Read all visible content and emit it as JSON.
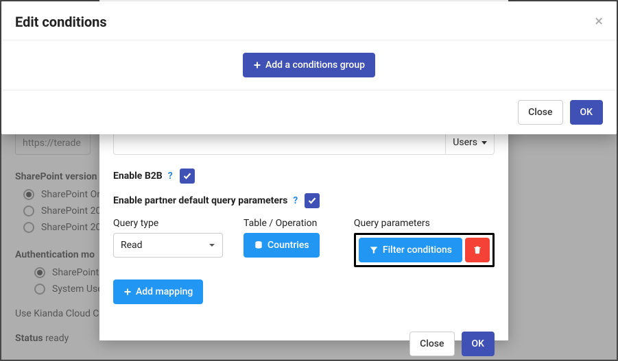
{
  "top_modal": {
    "title": "Edit conditions",
    "add_group_label": "Add a conditions group",
    "close_label": "Close",
    "ok_label": "OK"
  },
  "bg": {
    "url_value": "https://terade",
    "sp_version_label": "SharePoint version",
    "sp_options": [
      "SharePoint On",
      "SharePoint 20",
      "SharePoint 20"
    ],
    "auth_label": "Authentication mo",
    "auth_options": [
      "SharePoint C",
      "System User"
    ],
    "cloud_text": "Use Kianda Cloud Con",
    "status_label": "Status",
    "status_value": "ready"
  },
  "inner": {
    "users_label": "Users",
    "enable_b2b_label": "Enable B2B",
    "enable_partner_label": "Enable partner default query parameters",
    "query_type_label": "Query type",
    "query_type_value": "Read",
    "table_op_label": "Table / Operation",
    "countries_label": "Countries",
    "query_params_label": "Query parameters",
    "filter_conditions_label": "Filter conditions",
    "add_mapping_label": "Add mapping",
    "close_label": "Close",
    "ok_label": "OK"
  }
}
